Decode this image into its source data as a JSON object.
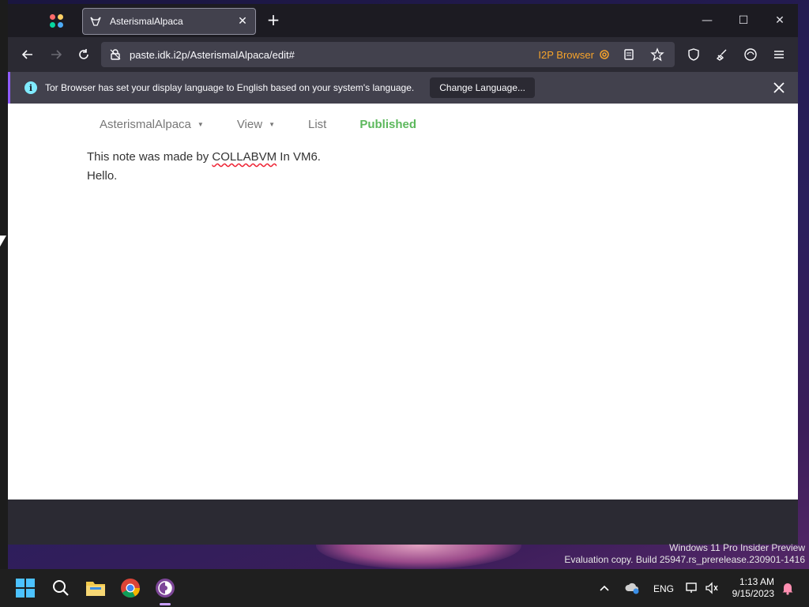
{
  "browser": {
    "tab": {
      "title": "AsterismalAlpaca",
      "close_symbol": "✕"
    },
    "new_tab_symbol": "+",
    "window_controls": {
      "minimize": "—",
      "maximize": "☐",
      "close": "✕"
    },
    "url": "paste.idk.i2p/AsterismalAlpaca/edit#",
    "url_badge": "I2P Browser",
    "notification": {
      "text": "Tor Browser has set your display language to English based on your system's language.",
      "button_label": "Change Language..."
    }
  },
  "page": {
    "nav": {
      "name_menu": "AsterismalAlpaca",
      "view_menu": "View",
      "list_link": "List",
      "status": "Published",
      "status_color": "#5cb85c"
    },
    "note": {
      "line1_before": "This note was made by ",
      "line1_word": "COLLABVM",
      "line1_after": " In VM6.",
      "line2": "Hello."
    }
  },
  "desktop": {
    "watermark_line1": "Windows 11 Pro Insider Preview",
    "watermark_line2": "Evaluation copy. Build 25947.rs_prerelease.230901-1416"
  },
  "taskbar": {
    "language": "ENG",
    "time": "1:13 AM",
    "date": "9/15/2023"
  }
}
